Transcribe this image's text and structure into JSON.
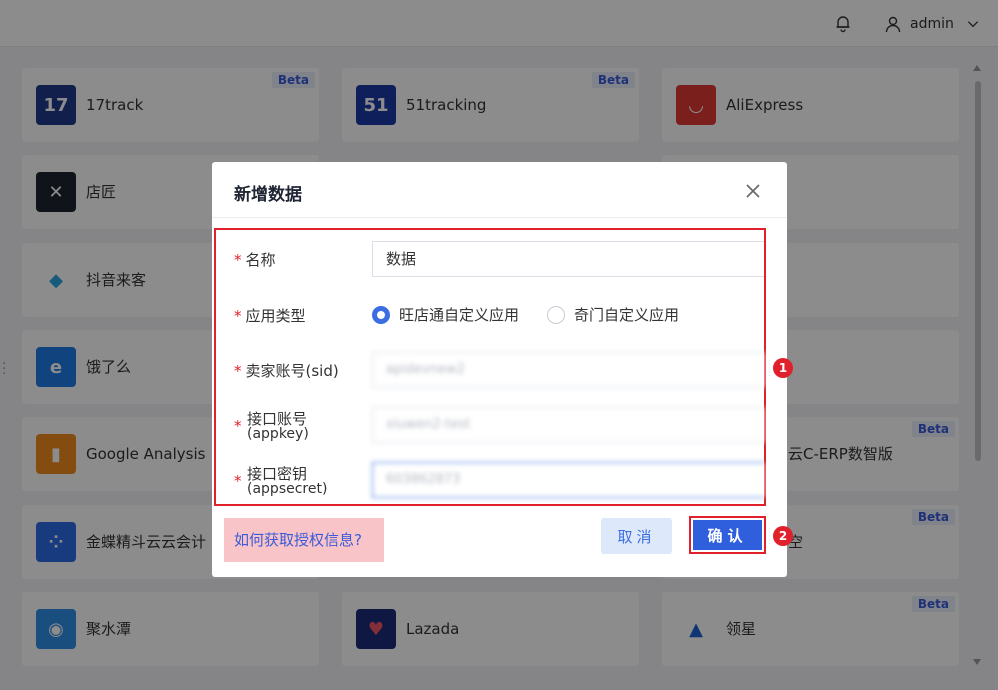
{
  "header": {
    "username": "admin",
    "bell_icon": "bell-icon",
    "user_icon": "user-icon",
    "chevron_icon": "chevron-down-icon"
  },
  "apps": [
    {
      "name": "17track",
      "beta": "Beta",
      "logo_text": "17",
      "color": "#1e3a8a"
    },
    {
      "name": "51tracking",
      "beta": "Beta",
      "logo_text": "51",
      "color": "#1a3aa6"
    },
    {
      "name": "AliExpress",
      "beta": "",
      "logo_text": "◡",
      "color": "#e03a35"
    },
    {
      "name": "店匠",
      "beta": "",
      "logo_text": "✕",
      "color": "#1e2330"
    },
    {
      "name": "抖音来客",
      "beta": "",
      "logo_text": "◆",
      "color": "#ffffff"
    },
    {
      "name": "饿了么",
      "beta": "",
      "logo_text": "e",
      "color": "#1f7ae6"
    },
    {
      "name": "Google Analysis",
      "beta": "",
      "logo_text": "▮",
      "color": "#f28a1e"
    },
    {
      "name": "云C-ERP数智版",
      "beta": "Beta",
      "logo_text": "",
      "color": ""
    },
    {
      "name": "金蝶精斗云云会计",
      "beta": "",
      "logo_text": "⁘",
      "color": "#2d6be6"
    },
    {
      "name": "空",
      "beta": "Beta",
      "logo_text": "",
      "color": ""
    },
    {
      "name": "聚水潭",
      "beta": "",
      "logo_text": "◉",
      "color": "#2e8fe8"
    },
    {
      "name": "Lazada",
      "beta": "",
      "logo_text": "♥",
      "color": "#1d2b7a"
    },
    {
      "name": "领星",
      "beta": "Beta",
      "logo_text": "▲",
      "color": "#ffffff"
    }
  ],
  "dialog": {
    "title": "新增数据",
    "close_icon": "close-icon",
    "required_mark": "*",
    "fields": {
      "name_label": "名称",
      "name_value": "数据",
      "type_label": "应用类型",
      "type_options": [
        "旺店通自定义应用",
        "奇门自定义应用"
      ],
      "type_selected": "旺店通自定义应用",
      "sid_label": "卖家账号(sid)",
      "sid_value": "apidevnew2",
      "appkey_label": "接口账号",
      "appkey_sub": "(appkey)",
      "appkey_value": "xiuwen2-test",
      "appsecret_label": "接口密钥",
      "appsecret_sub": "(appsecret)",
      "appsecret_value": "603862873"
    },
    "help_link": "如何获取授权信息?",
    "cancel_label": "取消",
    "ok_label": "确认"
  },
  "annotations": {
    "badge_1": "1",
    "badge_2": "2"
  }
}
